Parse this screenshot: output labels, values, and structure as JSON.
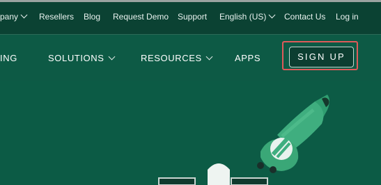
{
  "top_links": {
    "company": "pany",
    "resellers": "Resellers",
    "blog": "Blog",
    "request_demo": "Request Demo",
    "support": "Support",
    "language": "English (US)",
    "contact": "Contact Us",
    "login": "Log in"
  },
  "nav": {
    "pricing": "ING",
    "solutions": "SOLUTIONS",
    "resources": "RESOURCES",
    "apps": "APPS",
    "signup": "SIGN UP"
  },
  "colors": {
    "topbar": "#0b4233",
    "nav": "#0d5a45",
    "hero": "#0c5b45",
    "highlight": "#e05a5a",
    "illustration_green": "#3fae7f"
  },
  "icons": {
    "dropdown": "chevron-down-icon",
    "illustration": "robot-arm-illustration"
  }
}
